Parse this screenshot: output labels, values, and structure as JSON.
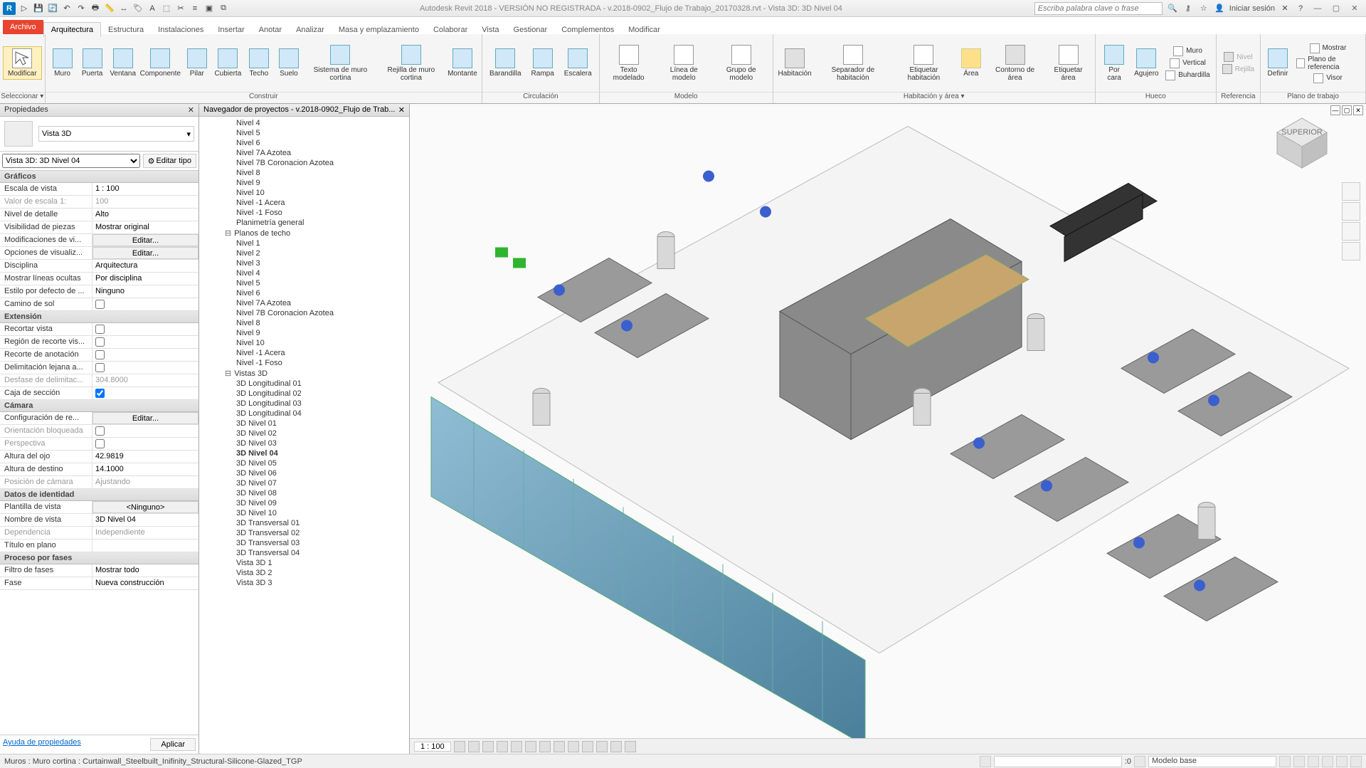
{
  "title": "Autodesk Revit 2018 - VERSIÓN NO REGISTRADA -   v.2018-0902_Flujo de Trabajo_20170328.rvt - Vista 3D: 3D Nivel 04",
  "search_placeholder": "Escriba palabra clave o frase",
  "login": "Iniciar sesión",
  "tabs": {
    "file": "Archivo",
    "items": [
      "Arquitectura",
      "Estructura",
      "Instalaciones",
      "Insertar",
      "Anotar",
      "Analizar",
      "Masa y emplazamiento",
      "Colaborar",
      "Vista",
      "Gestionar",
      "Complementos",
      "Modificar"
    ],
    "active": 0
  },
  "ribbon": {
    "select": {
      "modify": "Modificar",
      "label": "Seleccionar ▾"
    },
    "build": {
      "wall": "Muro",
      "door": "Puerta",
      "window": "Ventana",
      "component": "Componente",
      "column": "Pilar",
      "roof": "Cubierta",
      "ceiling": "Techo",
      "floor": "Suelo",
      "curtain_system": "Sistema de\nmuro cortina",
      "curtain_grid": "Rejilla de\nmuro cortina",
      "mullion": "Montante",
      "label": "Construir"
    },
    "circ": {
      "railing": "Barandilla",
      "ramp": "Rampa",
      "stair": "Escalera",
      "label": "Circulación"
    },
    "model": {
      "text": "Texto\nmodelado",
      "line": "Línea de\nmodelo",
      "group": "Grupo de\nmodelo",
      "label": "Modelo"
    },
    "room": {
      "room": "Habitación",
      "sep": "Separador\nde habitación",
      "tag": "Etiquetar\nhabitación",
      "area": "Área",
      "area_bound": "Contorno\nde área",
      "tag_area": "Etiquetar\nárea",
      "label": "Habitación y área ▾"
    },
    "opening": {
      "face": "Por\ncara",
      "shaft": "Agujero",
      "wall": "Muro",
      "vertical": "Vertical",
      "dormer": "Buhardilla",
      "label": "Hueco"
    },
    "datum": {
      "level": "Nivel",
      "grid": "Rejilla",
      "label": "Referencia"
    },
    "work": {
      "set": "Definir",
      "show": "Mostrar",
      "ref": "Plano de referencia",
      "viewer": "Visor",
      "label": "Plano de trabajo"
    }
  },
  "props": {
    "title": "Propiedades",
    "type_label": "Vista 3D",
    "instance": "Vista 3D: 3D Nivel 04",
    "edit_type": "Editar tipo",
    "sections": {
      "graphics": "Gráficos",
      "extents": "Extensión",
      "camera": "Cámara",
      "identity": "Datos de identidad",
      "phasing": "Proceso por fases"
    },
    "rows": {
      "view_scale": {
        "k": "Escala de vista",
        "v": "1 : 100"
      },
      "scale_value": {
        "k": "Valor de escala    1:",
        "v": "100"
      },
      "detail": {
        "k": "Nivel de detalle",
        "v": "Alto"
      },
      "parts": {
        "k": "Visibilidad de piezas",
        "v": "Mostrar original"
      },
      "vg": {
        "k": "Modificaciones de vi...",
        "v": "Editar..."
      },
      "disp": {
        "k": "Opciones de visualiz...",
        "v": "Editar..."
      },
      "discipline": {
        "k": "Disciplina",
        "v": "Arquitectura"
      },
      "hidden": {
        "k": "Mostrar líneas ocultas",
        "v": "Por disciplina"
      },
      "default": {
        "k": "Estilo por defecto de ...",
        "v": "Ninguno"
      },
      "sun": {
        "k": "Camino de sol",
        "v": ""
      },
      "crop": {
        "k": "Recortar vista",
        "v": ""
      },
      "crop_vis": {
        "k": "Región de recorte vis...",
        "v": ""
      },
      "anno_crop": {
        "k": "Recorte de anotación",
        "v": ""
      },
      "far_clip": {
        "k": "Delimitación lejana a...",
        "v": ""
      },
      "far_off": {
        "k": "Desfase de delimitac...",
        "v": "304.8000"
      },
      "section_box": {
        "k": "Caja de sección",
        "v": "checked"
      },
      "render": {
        "k": "Configuración de re...",
        "v": "Editar..."
      },
      "orient": {
        "k": "Orientación bloqueada",
        "v": ""
      },
      "persp": {
        "k": "Perspectiva",
        "v": ""
      },
      "eye": {
        "k": "Altura del ojo",
        "v": "42.9819"
      },
      "target": {
        "k": "Altura de destino",
        "v": "14.1000"
      },
      "cam_pos": {
        "k": "Posición de cámara",
        "v": "Ajustando"
      },
      "template": {
        "k": "Plantilla de vista",
        "v": "<Ninguno>"
      },
      "view_name": {
        "k": "Nombre de vista",
        "v": "3D Nivel 04"
      },
      "dep": {
        "k": "Dependencia",
        "v": "Independiente"
      },
      "sheet_title": {
        "k": "Título en plano",
        "v": ""
      },
      "phase_filter": {
        "k": "Filtro de fases",
        "v": "Mostrar todo"
      },
      "phase": {
        "k": "Fase",
        "v": "Nueva construcción"
      }
    },
    "help": "Ayuda de propiedades",
    "apply": "Aplicar"
  },
  "browser": {
    "title": "Navegador de proyectos - v.2018-0902_Flujo de Trab...",
    "items": [
      {
        "t": "Nivel 4",
        "l": 3
      },
      {
        "t": "Nivel 5",
        "l": 3
      },
      {
        "t": "Nivel 6",
        "l": 3
      },
      {
        "t": "Nivel 7A Azotea",
        "l": 3
      },
      {
        "t": "Nivel 7B Coronacion Azotea",
        "l": 3
      },
      {
        "t": "Nivel 8",
        "l": 3
      },
      {
        "t": "Nivel 9",
        "l": 3
      },
      {
        "t": "Nivel 10",
        "l": 3
      },
      {
        "t": "Nivel -1 Acera",
        "l": 3
      },
      {
        "t": "Nivel -1 Foso",
        "l": 3
      },
      {
        "t": "Planimetría general",
        "l": 3
      },
      {
        "t": "Planos de techo",
        "l": 2,
        "g": true
      },
      {
        "t": "Nivel 1",
        "l": 3
      },
      {
        "t": "Nivel 2",
        "l": 3
      },
      {
        "t": "Nivel 3",
        "l": 3
      },
      {
        "t": "Nivel 4",
        "l": 3
      },
      {
        "t": "Nivel 5",
        "l": 3
      },
      {
        "t": "Nivel 6",
        "l": 3
      },
      {
        "t": "Nivel 7A Azotea",
        "l": 3
      },
      {
        "t": "Nivel 7B Coronacion Azotea",
        "l": 3
      },
      {
        "t": "Nivel 8",
        "l": 3
      },
      {
        "t": "Nivel 9",
        "l": 3
      },
      {
        "t": "Nivel 10",
        "l": 3
      },
      {
        "t": "Nivel -1 Acera",
        "l": 3
      },
      {
        "t": "Nivel -1 Foso",
        "l": 3
      },
      {
        "t": "Vistas 3D",
        "l": 2,
        "g": true
      },
      {
        "t": "3D Longitudinal 01",
        "l": 3
      },
      {
        "t": "3D Longitudinal 02",
        "l": 3
      },
      {
        "t": "3D Longitudinal 03",
        "l": 3
      },
      {
        "t": "3D Longitudinal 04",
        "l": 3
      },
      {
        "t": "3D Nivel 01",
        "l": 3
      },
      {
        "t": "3D Nivel 02",
        "l": 3
      },
      {
        "t": "3D Nivel 03",
        "l": 3
      },
      {
        "t": "3D Nivel 04",
        "l": 3,
        "b": true
      },
      {
        "t": "3D Nivel 05",
        "l": 3
      },
      {
        "t": "3D Nivel 06",
        "l": 3
      },
      {
        "t": "3D Nivel 07",
        "l": 3
      },
      {
        "t": "3D Nivel 08",
        "l": 3
      },
      {
        "t": "3D Nivel 09",
        "l": 3
      },
      {
        "t": "3D Nivel 10",
        "l": 3
      },
      {
        "t": "3D Transversal 01",
        "l": 3
      },
      {
        "t": "3D Transversal 02",
        "l": 3
      },
      {
        "t": "3D Transversal 03",
        "l": 3
      },
      {
        "t": "3D Transversal 04",
        "l": 3
      },
      {
        "t": "Vista 3D 1",
        "l": 3
      },
      {
        "t": "Vista 3D 2",
        "l": 3
      },
      {
        "t": "Vista 3D 3",
        "l": 3
      }
    ]
  },
  "viewbar": {
    "scale": "1 : 100"
  },
  "status": {
    "hint": "Muros : Muro cortina : Curtainwall_Steelbuilt_Inifinity_Structural-Silicone-Glazed_TGP",
    "main_model": "Modelo base",
    "sel": ":0"
  }
}
